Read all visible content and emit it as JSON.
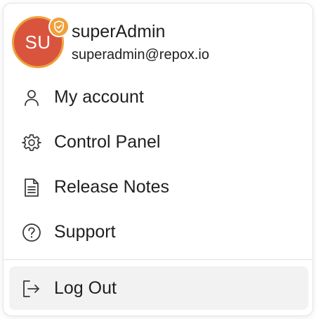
{
  "user": {
    "initials": "SU",
    "name": "superAdmin",
    "email": "superadmin@repox.io",
    "avatar_bg": "#d9543d",
    "avatar_ring": "#f0a03a",
    "badge_icon": "shield-check-icon"
  },
  "menu": {
    "items": [
      {
        "label": "My account",
        "icon": "user-icon"
      },
      {
        "label": "Control Panel",
        "icon": "gear-icon"
      },
      {
        "label": "Release Notes",
        "icon": "document-icon"
      },
      {
        "label": "Support",
        "icon": "help-circle-icon"
      }
    ],
    "logout": {
      "label": "Log Out",
      "icon": "logout-icon"
    }
  },
  "colors": {
    "icon_stroke": "#3a3a3a",
    "logout_bg": "#f2f2f2",
    "divider": "#e2e2e2"
  }
}
